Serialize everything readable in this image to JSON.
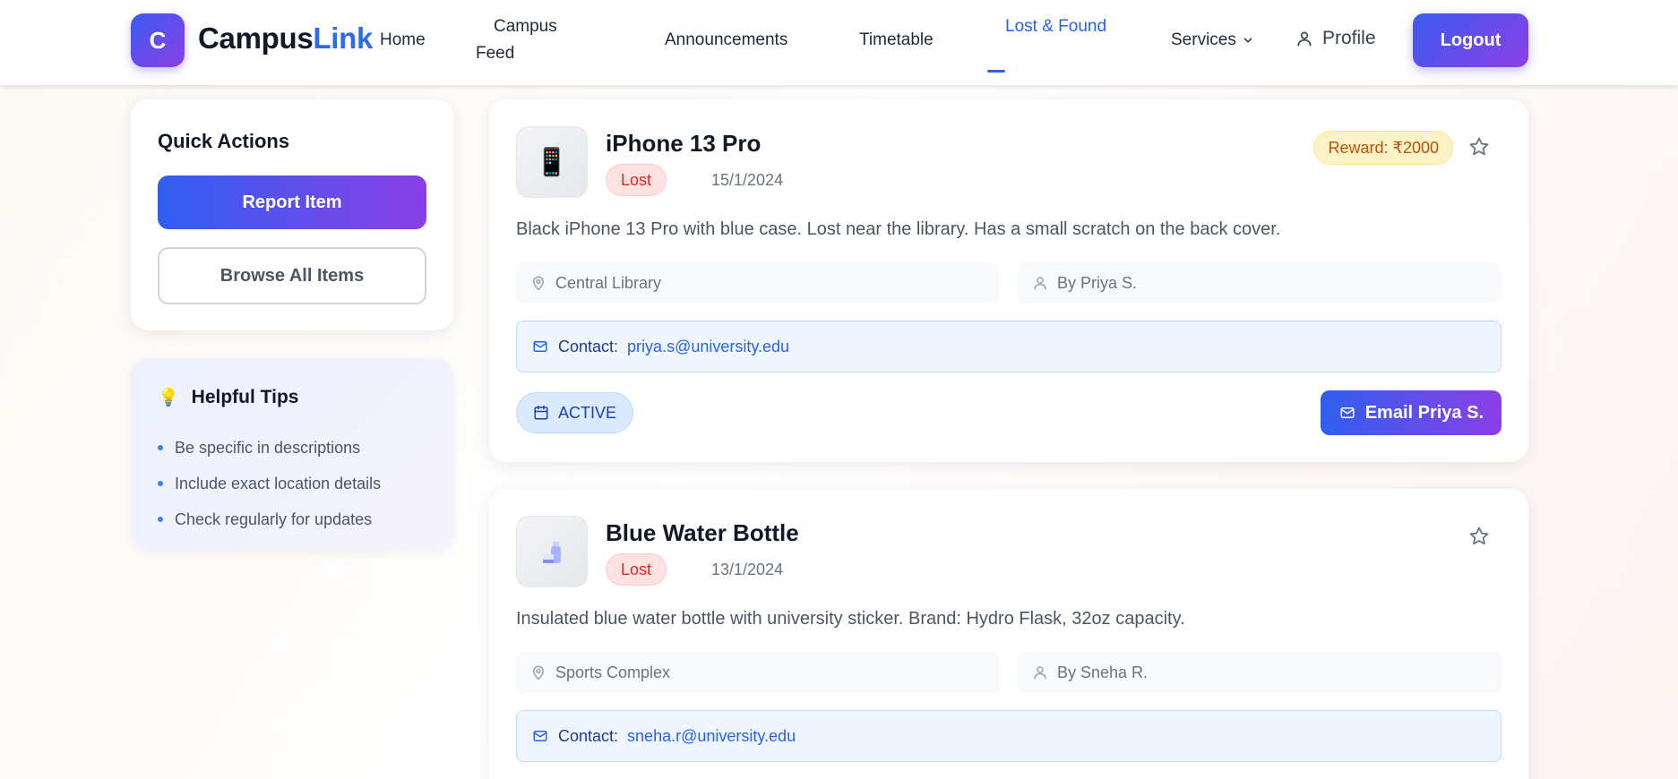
{
  "brand": {
    "logo_letter": "C",
    "name_part1": "Campus",
    "name_part2": "Link"
  },
  "nav": {
    "home": "Home",
    "feed_line1": "Campus",
    "feed_line2": "Feed",
    "announcements": "Announcements",
    "timetable": "Timetable",
    "lost_found": "Lost & Found",
    "services": "Services",
    "profile": "Profile",
    "logout": "Logout",
    "active": "Lost & Found"
  },
  "quick_actions": {
    "title": "Quick Actions",
    "report": "Report Item",
    "browse": "Browse All Items"
  },
  "tips": {
    "icon": "💡",
    "title": "Helpful Tips",
    "items": [
      "Be specific in descriptions",
      "Include exact location details",
      "Check regularly for updates"
    ]
  },
  "items": [
    {
      "thumb_icon": "📱",
      "title": "iPhone 13 Pro",
      "status": "Lost",
      "date": "15/1/2024",
      "reward": "Reward: ₹2000",
      "description": "Black iPhone 13 Pro with blue case. Lost near the library. Has a small scratch on the back cover.",
      "location": "Central Library",
      "by": "By Priya S.",
      "contact_label": "Contact:",
      "contact_email": "priya.s@university.edu",
      "state": "ACTIVE",
      "email_button": "Email Priya S."
    },
    {
      "thumb_icon": "water-bottle-icon",
      "title": "Blue Water Bottle",
      "status": "Lost",
      "date": "13/1/2024",
      "description": "Insulated blue water bottle with university sticker. Brand: Hydro Flask, 32oz capacity.",
      "location": "Sports Complex",
      "by": "By Sneha R.",
      "contact_label": "Contact:",
      "contact_email": "sneha.r@university.edu"
    }
  ],
  "colors": {
    "accent_blue": "#2563eb",
    "gradient_start": "#3b5bf0",
    "gradient_end": "#8b3fe6",
    "lost_red": "#dc2626",
    "reward_amber": "#b45309"
  }
}
